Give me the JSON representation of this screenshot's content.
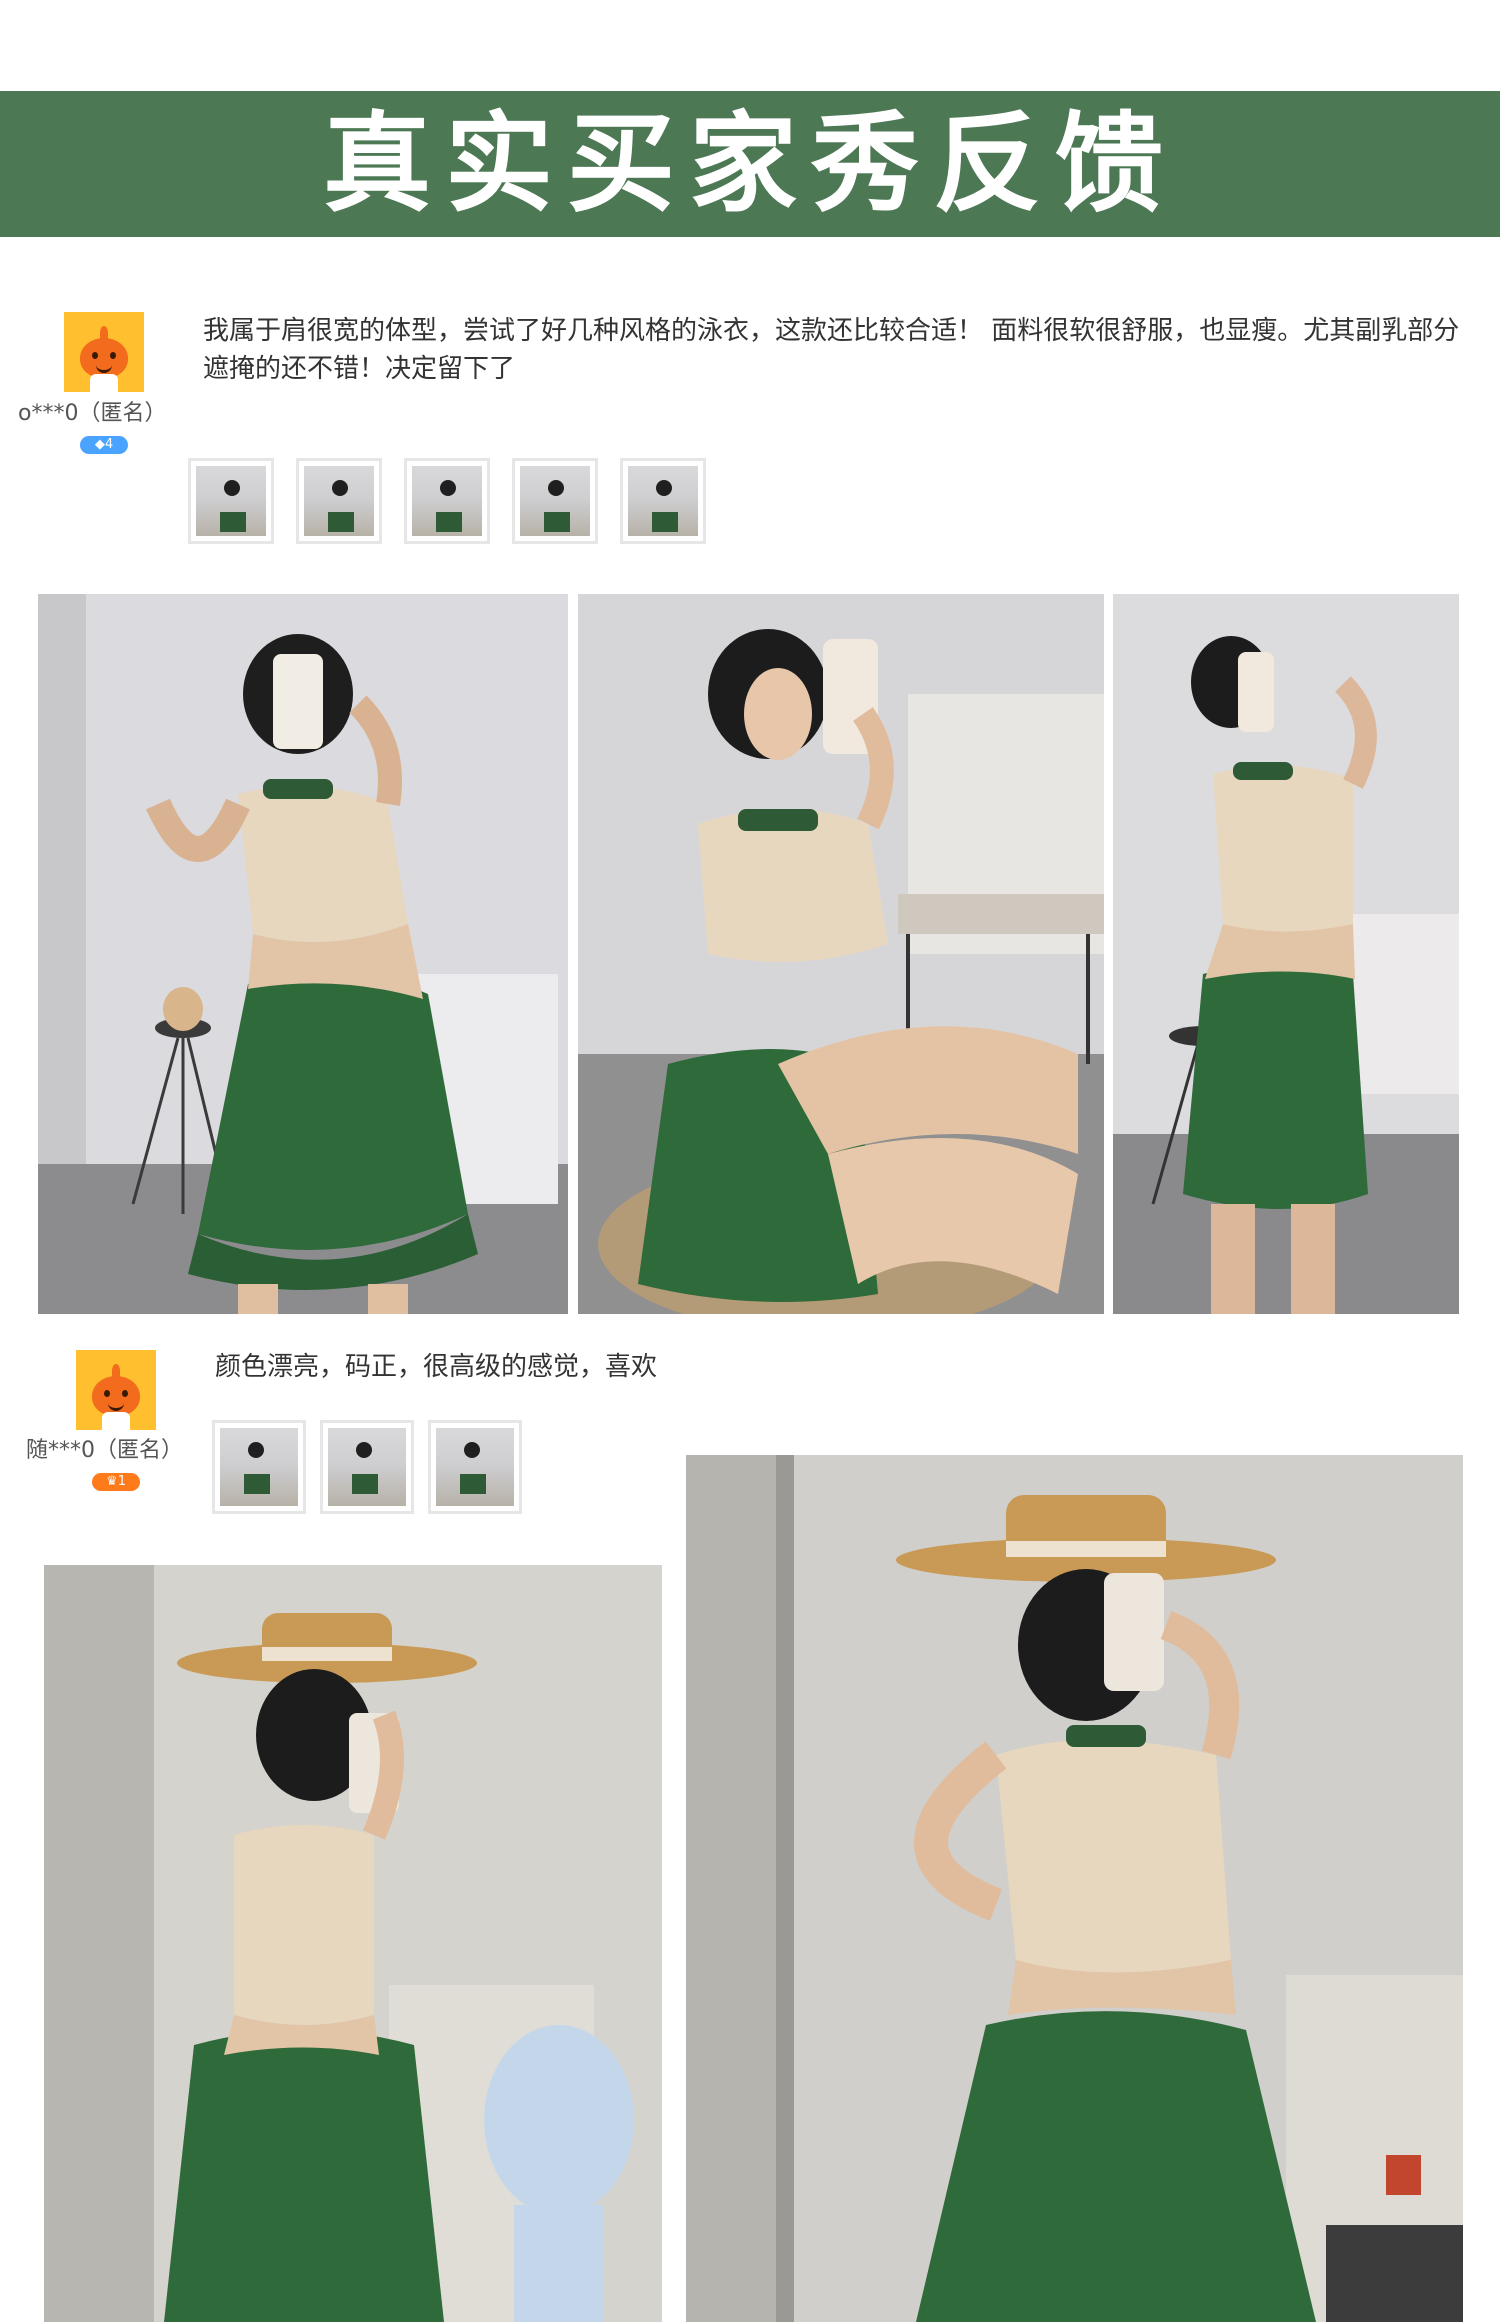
{
  "banner": {
    "title": "真实买家秀反馈"
  },
  "reviews": [
    {
      "user": "o***0（匿名）",
      "badge": "4",
      "text": "我属于肩很宽的体型，尝试了好几种风格的泳衣，这款还比较合适！ 面料很软很舒服，也显瘦。尤其副乳部分遮掩的还不错！决定留下了",
      "thumbnail_count": 5,
      "photo_count": 3
    },
    {
      "user": "随***0（匿名）",
      "badge": "1",
      "text": "颜色漂亮，码正，很高级的感觉，喜欢",
      "thumbnail_count": 3,
      "photo_count": 2
    }
  ],
  "colors": {
    "banner_green": "#4d7854",
    "skirt_green": "#2f6a3a",
    "top_beige": "#e8d7bf",
    "badge_blue": "#4aa3ff",
    "badge_orange": "#ff7a1a"
  }
}
